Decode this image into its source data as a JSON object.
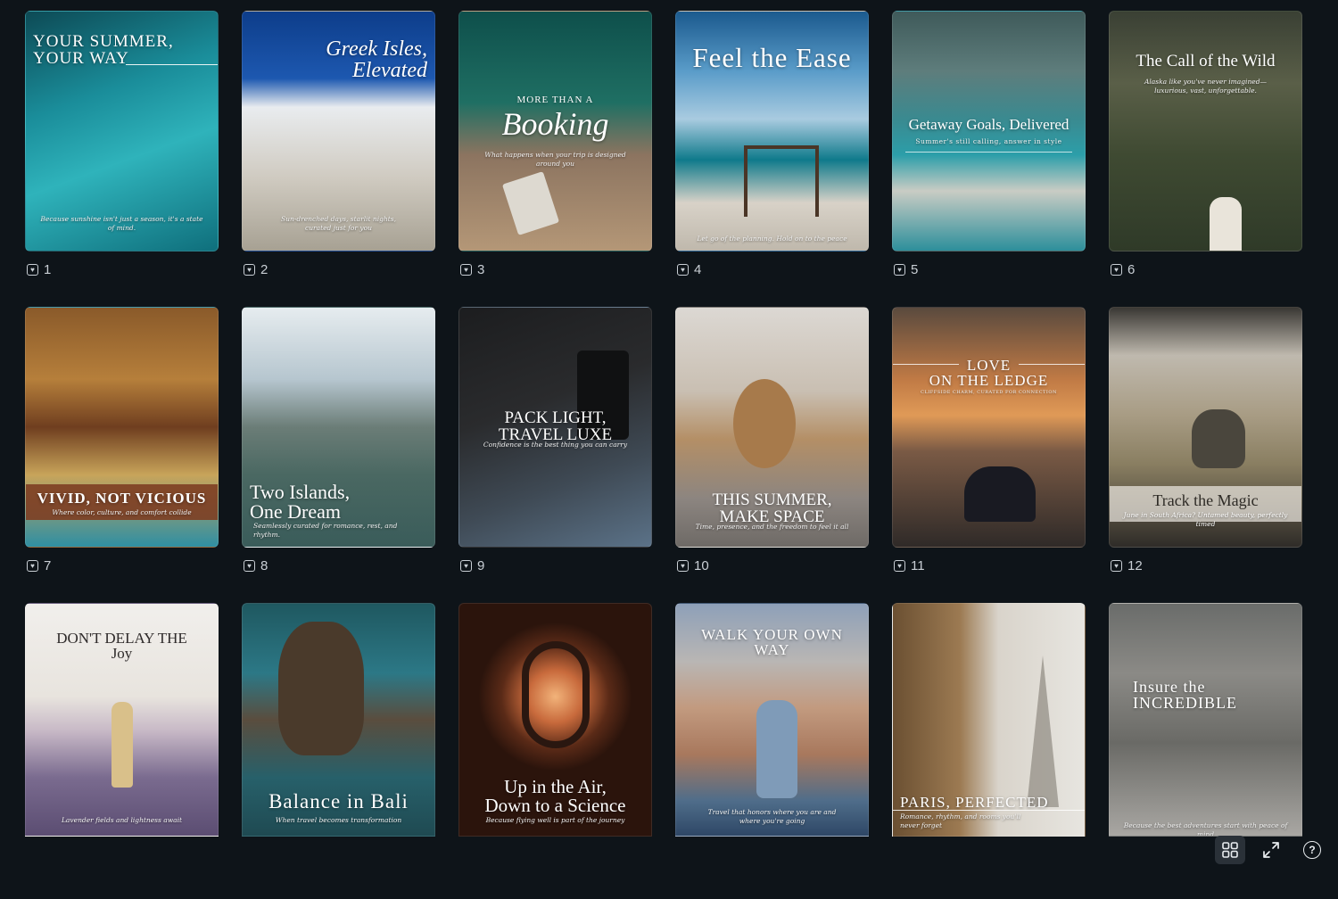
{
  "cards": [
    {
      "number": "1",
      "title": "YOUR SUMMER,\nYOUR WAY",
      "caption": "Because sunshine isn't just a season, it's a state of mind.",
      "bg": "linear-gradient(160deg,#0d4a55 0%,#1a8d9a 35%,#2fb3bb 60%,#0f6f7c 100%)"
    },
    {
      "number": "2",
      "title": "Greek Isles,\nElevated",
      "caption": "Sun-drenched days, starlit nights, curated just for you",
      "bg": "linear-gradient(180deg,#0d3d8a 0%,#1d58b0 28%,#e9ecef 40%,#cfcac0 70%,#a7a193 100%)"
    },
    {
      "number": "3",
      "title": "MORE THAN A",
      "subtitle": "Booking",
      "caption": "What happens when your trip is designed around you",
      "bg": "linear-gradient(180deg,#0e4f4b 0%,#1f6f63 38%,#8c7460 60%,#b49777 100%)"
    },
    {
      "number": "4",
      "title": "Feel the Ease",
      "caption": "Let go of the planning. Hold on to the peace",
      "bg": "linear-gradient(180deg,#1b5a8e 0%,#5a9cc9 25%,#a9cbe0 45%,#0f7a8b 62%,#d8d2c8 80%,#bfb8ac 100%)"
    },
    {
      "number": "5",
      "title": "Getaway Goals, Delivered",
      "caption": "Summer's still calling, answer in style",
      "bg": "linear-gradient(180deg,#3f5a5a 0%,#5e7d7c 25%,#3a8a90 45%,#2c9ea9 60%,#c9ccc4 75%,#2d8f9b 100%)"
    },
    {
      "number": "6",
      "title": "The Call of the Wild",
      "caption": "Alaska like you've never imagined—luxurious, vast, unforgettable.",
      "bg": "linear-gradient(180deg,#3a4034 0%,#5a5f48 30%,#3f4a32 60%,#2f3a28 100%)"
    },
    {
      "number": "7",
      "title": "VIVID, NOT VICIOUS",
      "caption": "Where color, culture, and comfort collide",
      "bg": "linear-gradient(180deg,#8a5a2a 0%,#b67f3b 30%,#6f3e1f 50%,#c8a45a 70%,#2f8fa3 100%)"
    },
    {
      "number": "8",
      "title": "Two Islands,\nOne Dream",
      "caption": "Seamlessly curated for romance, rest, and rhythm.",
      "bg": "linear-gradient(180deg,#e6ecef 0%,#b6c6cf 30%,#6b7d77 50%,#4a6862 70%,#3a5c5a 100%)"
    },
    {
      "number": "9",
      "title": "PACK LIGHT,\nTRAVEL LUXE",
      "caption": "Confidence is the best thing you can carry",
      "bg": "linear-gradient(160deg,#1c1d1f 0%,#2a2b2d 40%,#3f4a55 70%,#5b7288 100%)"
    },
    {
      "number": "10",
      "title": "THIS SUMMER,\nMAKE SPACE",
      "caption": "Time, presence, and the freedom to feel it all",
      "bg": "linear-gradient(180deg,#dcd8d3 0%,#c9bfb2 35%,#b48f66 55%,#8c8580 80%,#6e6a66 100%)"
    },
    {
      "number": "11",
      "title": "LOVE\nON THE LEDGE",
      "caption": "CLIFFSIDE CHARM, CURATED FOR CONNECTION",
      "bg": "linear-gradient(180deg,#5a4a3e 0%,#c07a45 30%,#e09a57 45%,#7a5a45 60%,#2f2a28 100%)"
    },
    {
      "number": "12",
      "title": "Track the Magic",
      "caption": "June in South Africa? Untamed beauty, perfectly timed",
      "bg": "linear-gradient(180deg,#3a3834 0%,#bfb9ae 20%,#a89c84 45%,#8a7f62 65%,#2f2c28 100%)"
    },
    {
      "number": "",
      "title": "DON'T DELAY THE\nJoy",
      "caption": "Lavender fields and lightness await",
      "bg": "linear-gradient(180deg,#f1efec 0%,#e8e4de 40%,#c7b8c6 55%,#7a6b8f 75%,#5b4d72 100%)"
    },
    {
      "number": "",
      "title": "Balance in Bali",
      "caption": "When travel becomes transformation",
      "bg": "linear-gradient(180deg,#1f5860 0%,#2c7886 30%,#5a4d3e 50%,#27606a 75%,#1f4a52 100%)"
    },
    {
      "number": "",
      "title": "Up in the Air,\nDown to a Science",
      "caption": "Because flying well is part of the journey",
      "bg": "radial-gradient(ellipse 40% 32% at 50% 40%, #f2b37a 0%, #c86a3c 35%, #5a2a17 70%, #2b140c 100%)"
    },
    {
      "number": "",
      "title": "WALK YOUR OWN\nWAY",
      "caption": "Travel that honors where you are and where you're going",
      "bg": "linear-gradient(180deg,#8ea0b8 0%,#b9b6b4 25%,#c29a7f 45%,#a8785d 65%,#4f6d8a 85%,#2e4766 100%)"
    },
    {
      "number": "",
      "title": "PARIS, PERFECTED",
      "caption": "Romance, rhythm, and rooms you'll never forget",
      "bg": "linear-gradient(90deg,#6b5032 0%,#9c7a52 35%,#d9d4cb 55%,#e7e5e0 100%)"
    },
    {
      "number": "",
      "title": "Insure the\nINCREDIBLE",
      "caption": "Because the best adventures start with peace of mind",
      "bg": "linear-gradient(180deg,#6a6c6a 0%,#8b8a86 30%,#6a6a66 60%,#a9a7a3 100%)"
    }
  ],
  "toolbar": {
    "grid_icon": "grid-view-icon",
    "fullscreen_icon": "fullscreen-icon",
    "help_label": "?"
  }
}
